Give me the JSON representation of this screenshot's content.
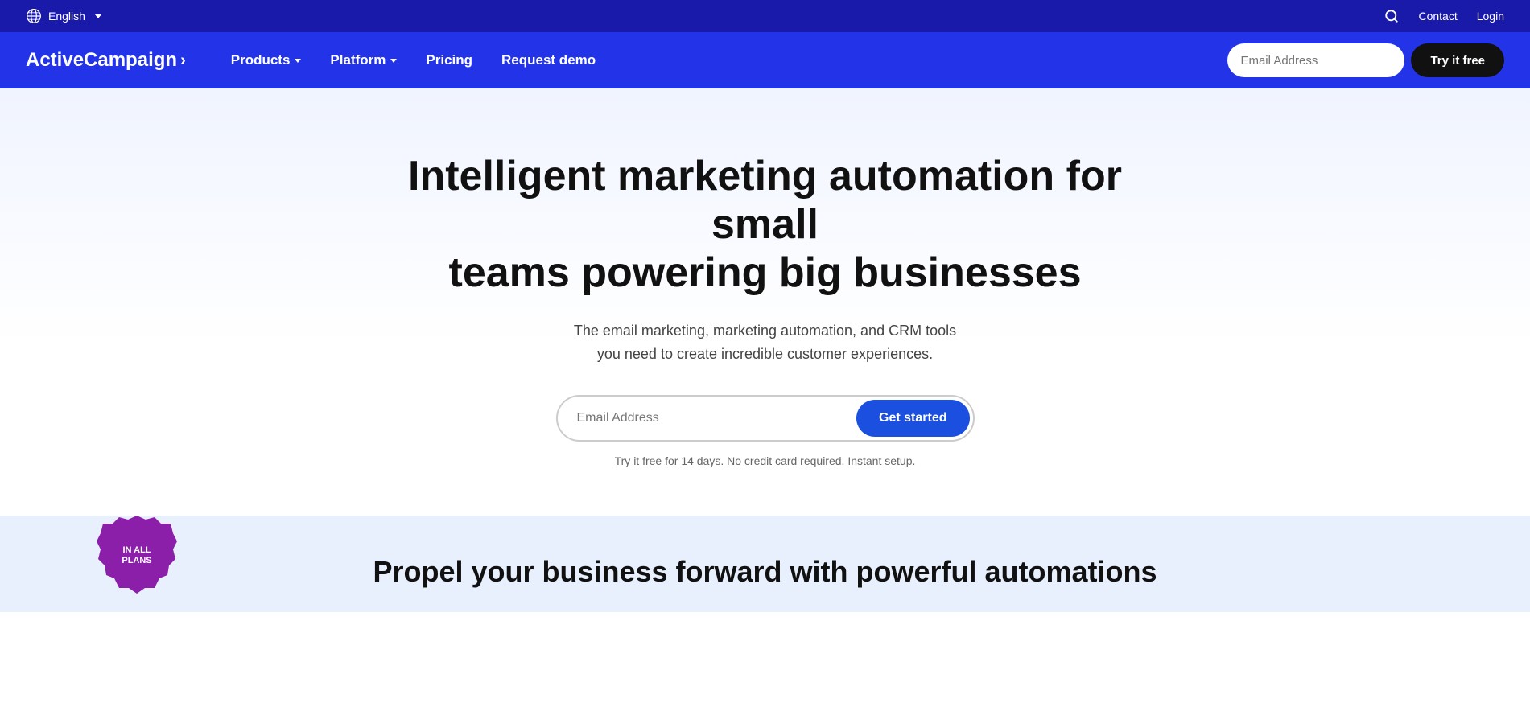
{
  "topbar": {
    "language_label": "English",
    "contact_label": "Contact",
    "login_label": "Login"
  },
  "nav": {
    "logo_text": "ActiveCampaign",
    "logo_arrow": "›",
    "links": [
      {
        "label": "Products",
        "has_dropdown": true
      },
      {
        "label": "Platform",
        "has_dropdown": true
      },
      {
        "label": "Pricing",
        "has_dropdown": false
      },
      {
        "label": "Request demo",
        "has_dropdown": false
      }
    ],
    "email_placeholder": "Email Address",
    "try_free_label": "Try it free"
  },
  "hero": {
    "heading_line1": "Intelligent marketing automation for small",
    "heading_line2": "teams powering big businesses",
    "subtitle": "The email marketing, marketing automation, and CRM tools you need to create incredible customer experiences.",
    "email_placeholder": "Email Address",
    "cta_label": "Get started",
    "fine_print": "Try it free for 14 days. No credit card required. Instant setup."
  },
  "bottom": {
    "badge_text_line1": "IN ALL",
    "badge_text_line2": "PLANS",
    "heading": "Propel your business forward with powerful automations"
  },
  "colors": {
    "top_bar_bg": "#1a1aaa",
    "nav_bg": "#2334e8",
    "try_free_bg": "#111111",
    "get_started_bg": "#1a4fe0",
    "badge_bg": "#8b1fa9",
    "hero_bg": "#f0f4ff",
    "bottom_bg": "#e8f0fe"
  }
}
